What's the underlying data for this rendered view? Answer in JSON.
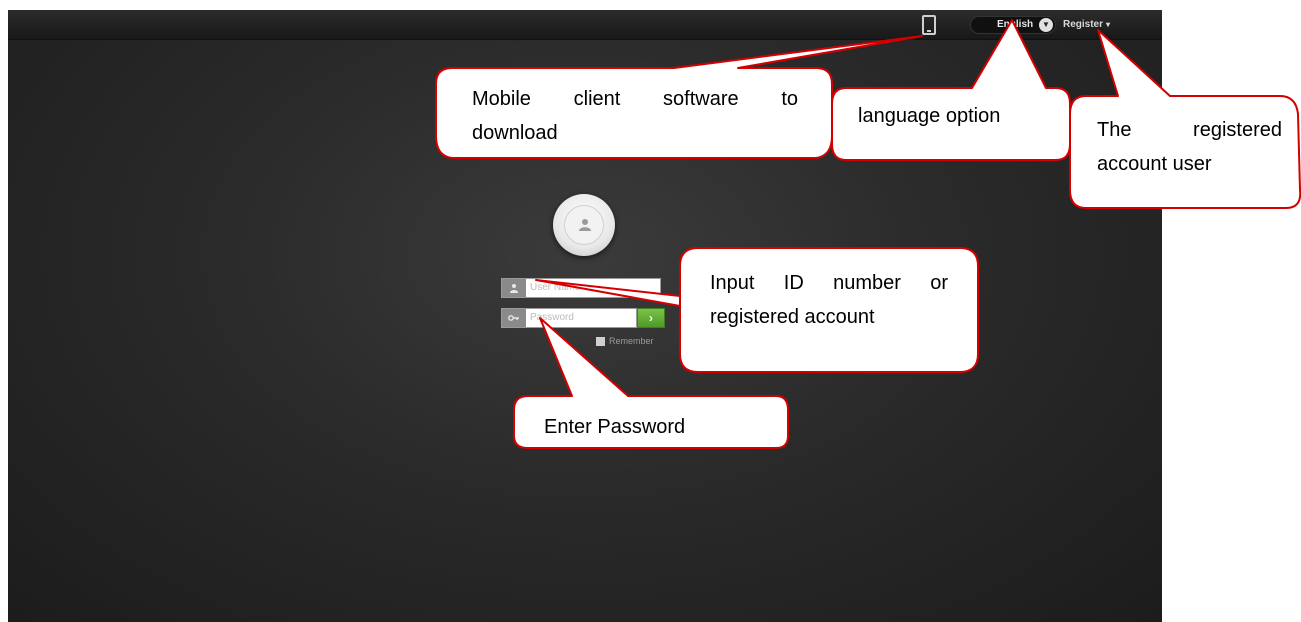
{
  "topbar": {
    "language_label": "English",
    "register_label": "Register",
    "mobile_icon": "tablet-icon",
    "dropdown_icon": "chevron-down-icon"
  },
  "login": {
    "avatar_icon": "user-icon",
    "username_placeholder": "User Name",
    "password_placeholder": "Password",
    "submit_icon": "arrow-right-icon",
    "remember_label": "Remember"
  },
  "annotations": {
    "mobile": "Mobile client software to download",
    "mobile_line1": "Mobile client software to",
    "mobile_line2": "download",
    "language": "language option",
    "register_line1": "The registered",
    "register_line2": "account user",
    "input_line1": "Input ID number or",
    "input_line2": "registered account",
    "password": "Enter Password"
  },
  "colors": {
    "callout_border": "#d40000",
    "go_button": "#5faa32",
    "background": "#262626"
  }
}
